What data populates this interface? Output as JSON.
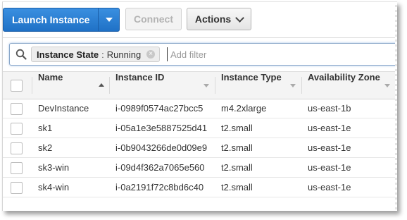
{
  "toolbar": {
    "launch_label": "Launch Instance",
    "connect_label": "Connect",
    "actions_label": "Actions"
  },
  "search": {
    "chip_key": "Instance State",
    "chip_separator": ":",
    "chip_value": "Running",
    "placeholder": "Add filter",
    "value": ""
  },
  "table": {
    "columns": [
      "Name",
      "Instance ID",
      "Instance Type",
      "Availability Zone"
    ],
    "rows": [
      {
        "name": "DevInstance",
        "id": "i-0989f0574ac27bcc5",
        "type": "m4.2xlarge",
        "zone": "us-east-1b"
      },
      {
        "name": "sk1",
        "id": "i-05a1e3e5887525d41",
        "type": "t2.small",
        "zone": "us-east-1e"
      },
      {
        "name": "sk2",
        "id": "i-0b9043266de0d09e9",
        "type": "t2.small",
        "zone": "us-east-1e"
      },
      {
        "name": "sk3-win",
        "id": "i-09d4f362a7065e560",
        "type": "t2.small",
        "zone": "us-east-1e"
      },
      {
        "name": "sk4-win",
        "id": "i-0a2191f72c8bd6c40",
        "type": "t2.small",
        "zone": "us-east-1e"
      }
    ]
  },
  "colors": {
    "primary": "#1f71c6",
    "header_bg": "#f4f4f4"
  },
  "icons": {
    "search": "search-icon",
    "dropdown": "caret-down-icon",
    "chip_remove": "close-circle-icon",
    "sort": "sort-ascending-icon"
  }
}
